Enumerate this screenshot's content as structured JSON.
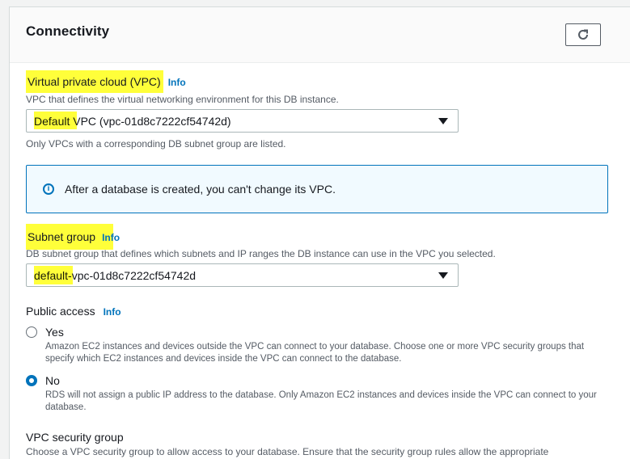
{
  "section": {
    "title": "Connectivity",
    "refresh_icon": "refresh-icon"
  },
  "vpc": {
    "label": "Virtual private cloud (VPC)",
    "info": "Info",
    "description": "VPC that defines the virtual networking environment for this DB instance.",
    "selected_value": "Default VPC (vpc-01d8c7222cf54742d)",
    "hint": "Only VPCs with a corresponding DB subnet group are listed."
  },
  "alert": {
    "icon": "info-icon",
    "text": "After a database is created, you can't change its VPC."
  },
  "subnet": {
    "label": "Subnet group",
    "info": "Info",
    "description": "DB subnet group that defines which subnets and IP ranges the DB instance can use in the VPC you selected.",
    "selected_value": "default-vpc-01d8c7222cf54742d"
  },
  "public_access": {
    "label": "Public access",
    "info": "Info",
    "options": [
      {
        "label": "Yes",
        "selected": false,
        "description": "Amazon EC2 instances and devices outside the VPC can connect to your database. Choose one or more VPC security groups that specify which EC2 instances and devices inside the VPC can connect to the database."
      },
      {
        "label": "No",
        "selected": true,
        "description": "RDS will not assign a public IP address to the database. Only Amazon EC2 instances and devices inside the VPC can connect to your database."
      }
    ]
  },
  "security_group": {
    "label": "VPC security group",
    "description": "Choose a VPC security group to allow access to your database. Ensure that the security group rules allow the appropriate"
  },
  "colors": {
    "highlight": "#ffff3a",
    "link": "#0073bb",
    "selected_radio": "#0073bb"
  }
}
